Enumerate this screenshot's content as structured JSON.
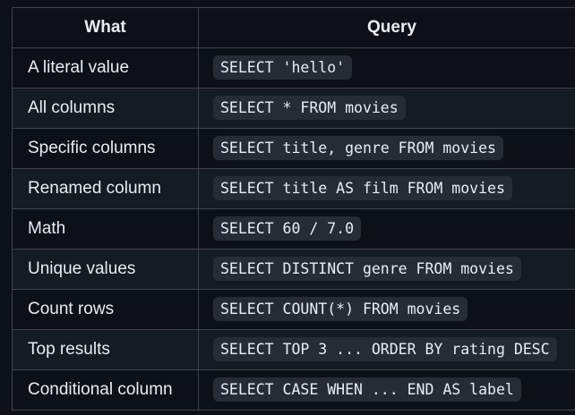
{
  "table": {
    "headers": [
      "What",
      "Query"
    ],
    "rows": [
      {
        "what": "A literal value",
        "query": "SELECT 'hello'"
      },
      {
        "what": "All columns",
        "query": "SELECT * FROM movies"
      },
      {
        "what": "Specific columns",
        "query": "SELECT title, genre FROM movies"
      },
      {
        "what": "Renamed column",
        "query": "SELECT title AS film FROM movies"
      },
      {
        "what": "Math",
        "query": "SELECT 60 / 7.0"
      },
      {
        "what": "Unique values",
        "query": "SELECT DISTINCT genre FROM movies"
      },
      {
        "what": "Count rows",
        "query": "SELECT COUNT(*) FROM movies"
      },
      {
        "what": "Top results",
        "query": "SELECT TOP 3 ... ORDER BY rating DESC"
      },
      {
        "what": "Conditional column",
        "query": "SELECT CASE WHEN ... END AS label"
      }
    ]
  },
  "colors": {
    "background": "#0d1117",
    "row_alt": "#151b23",
    "border": "#3d444d",
    "code_bg": "#262c36",
    "text": "#e6edf3"
  }
}
